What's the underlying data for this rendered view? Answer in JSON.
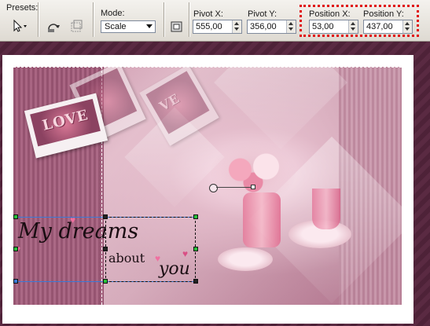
{
  "toolbar": {
    "presets_label": "Presets:",
    "mode_label": "Mode:",
    "mode_value": "Scale",
    "pivot_x_label": "Pivot X:",
    "pivot_x_value": "555,00",
    "pivot_y_label": "Pivot Y:",
    "pivot_y_value": "356,00",
    "position_x_label": "Position X:",
    "position_x_value": "53,00",
    "position_y_label": "Position Y:",
    "position_y_value": "437,00"
  },
  "canvas": {
    "polaroid_text": "LOVE",
    "polaroid_text_2": "VE",
    "caption_line1": "My dreams",
    "caption_line2": "about",
    "caption_line3": "you"
  },
  "colors": {
    "highlight": "#e01010",
    "selection_blue": "#3a79d6",
    "handle_green": "#27c23a"
  }
}
